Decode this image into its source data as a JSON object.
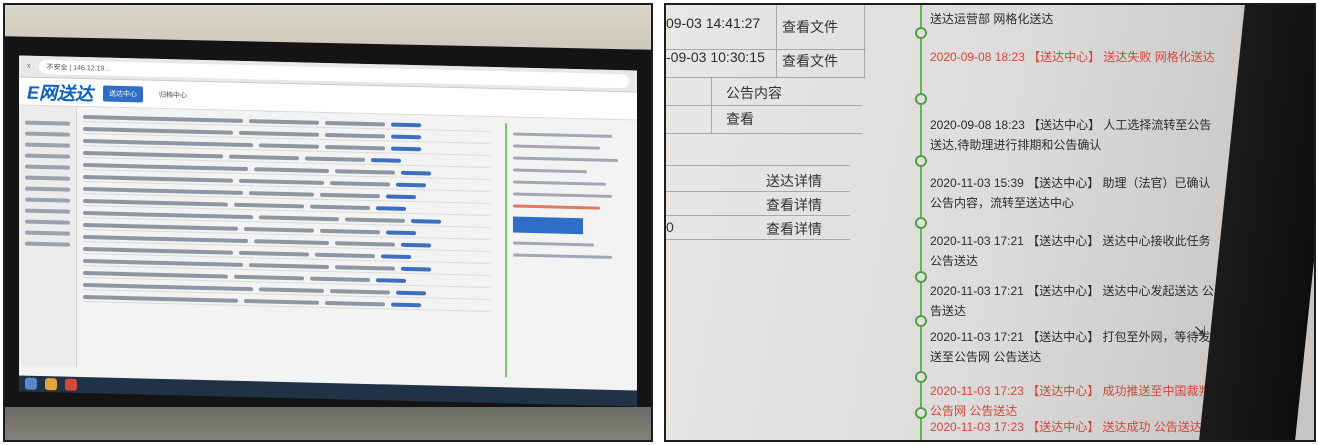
{
  "left_photo": {
    "browser": {
      "tab_label": "x",
      "url_text": "不安全 | 146.12.19..."
    },
    "site": {
      "logo": "E网送达",
      "tabs": [
        "送达中心",
        "归档中心"
      ]
    }
  },
  "right_photo": {
    "table_rows": [
      {
        "time": "09-03 14:41:27",
        "action": "查看文件"
      },
      {
        "time": "-09-03 10:30:15",
        "action": "查看文件"
      }
    ],
    "notice_header": "公告内容",
    "notice_view": "查看",
    "details": [
      "送达详情",
      "查看详情",
      "查看详情"
    ],
    "row_zero": "0",
    "timeline": [
      {
        "text": "送达运营部 网格化送达",
        "red": false
      },
      {
        "text": "2020-09-08 18:23 【送达中心】 送达失败 网格化送达",
        "red": true
      },
      {
        "text": "2020-09-08 18:23 【送达中心】 人工选择流转至公告送达,待助理进行排期和公告确认",
        "red": false
      },
      {
        "text": "2020-11-03 15:39 【送达中心】 助理（法官）已确认公告内容，流转至送达中心",
        "red": false
      },
      {
        "text": "2020-11-03 17:21 【送达中心】 送达中心接收此任务 公告送达",
        "red": false
      },
      {
        "text": "2020-11-03 17:21 【送达中心】 送达中心发起送达 公告送达",
        "red": false
      },
      {
        "text": "2020-11-03 17:21 【送达中心】 打包至外网，等待发送至公告网 公告送达",
        "red": false
      },
      {
        "text": "2020-11-03 17:23 【送达中心】 成功推送至中国裁判公告网 公告送达",
        "red": true
      },
      {
        "text": "2020-11-03 17:23 【送达中心】 送达成功 公告送达",
        "red": true
      }
    ]
  }
}
